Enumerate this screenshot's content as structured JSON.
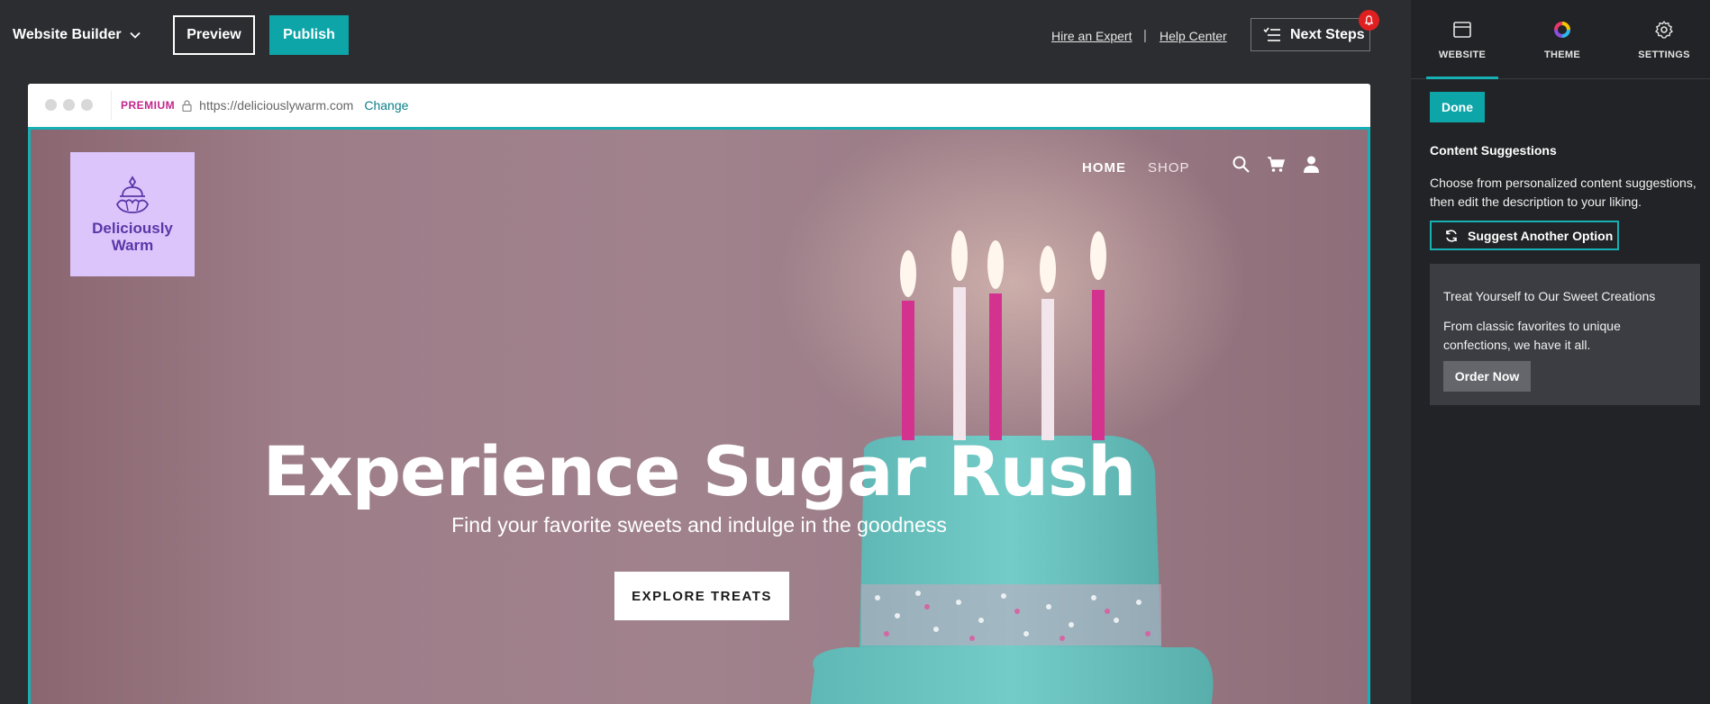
{
  "topbar": {
    "brand": "Website Builder",
    "preview_label": "Preview",
    "publish_label": "Publish",
    "hire_label": "Hire an Expert",
    "separator": "|",
    "help_label": "Help Center",
    "next_steps_label": "Next Steps"
  },
  "browser": {
    "premium_label": "PREMIUM",
    "url": "https://deliciouslywarm.com",
    "change_label": "Change"
  },
  "site": {
    "logo_text_line1": "Deliciously",
    "logo_text_line2": "Warm",
    "nav": [
      "HOME",
      "SHOP"
    ],
    "hero_title": "Experience Sugar Rush",
    "hero_subtitle": "Find your favorite sweets and indulge in the goodness",
    "hero_cta": "EXPLORE TREATS",
    "icons": [
      "search-icon",
      "cart-icon",
      "account-icon"
    ]
  },
  "panel": {
    "tabs": [
      {
        "label": "WEBSITE",
        "icon": "browser-window-icon",
        "active": true
      },
      {
        "label": "THEME",
        "icon": "color-wheel-icon",
        "active": false
      },
      {
        "label": "SETTINGS",
        "icon": "gear-icon",
        "active": false
      }
    ],
    "done_label": "Done",
    "section_title": "Content Suggestions",
    "section_desc": "Choose from personalized content suggestions, then edit the description to your liking.",
    "suggest_label": "Suggest Another Option",
    "card": {
      "title": "Treat Yourself to Our Sweet Creations",
      "desc": "From classic favorites to unique confections, we have it all.",
      "button_label": "Order Now"
    }
  },
  "colors": {
    "accent": "#0ea5a8",
    "premium": "#c2258b",
    "notification": "#e02020",
    "logo_bg": "#dcc5fb",
    "logo_text": "#5a37a8"
  }
}
